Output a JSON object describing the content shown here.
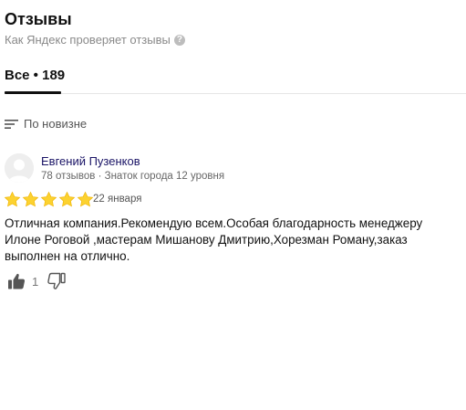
{
  "header": {
    "title": "Отзывы",
    "verify_link": "Как Яндекс проверяет отзывы",
    "help_icon": "question-circle-icon"
  },
  "tabs": [
    {
      "label": "Все • 189",
      "active": true
    }
  ],
  "sort": {
    "label": "По новизне",
    "icon": "sort-lines-icon"
  },
  "reviews": [
    {
      "author": "Евгений Пузенков",
      "meta": "78 отзывов · Знаток города 12 уровня",
      "rating": 5,
      "date": "22 января",
      "text": "Отличная компания.Рекомендую всем.Особая благодарность менеджеру Илоне Роговой ,мастерам Мишанову Дмитрию,Хорезман Роману,заказ выполнен на отлично.",
      "likes": "1"
    }
  ],
  "colors": {
    "star": "#fcd230",
    "star_stroke": "#f0b400",
    "author_link": "#1a1466",
    "muted": "#8a8a8a"
  }
}
